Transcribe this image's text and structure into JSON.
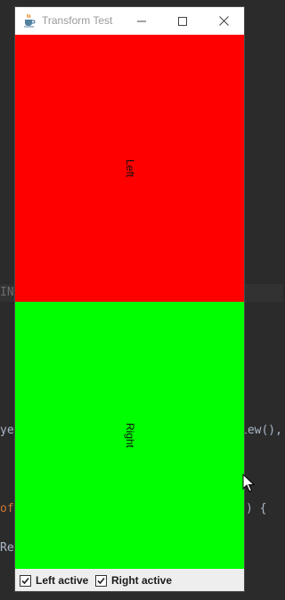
{
  "window": {
    "title": "Transform Test"
  },
  "panels": {
    "left_label": "Left",
    "right_label": "Right",
    "left_color": "#ff0000",
    "right_color": "#00ff00"
  },
  "controls": {
    "left_active_label": "Left active",
    "right_active_label": "Right active",
    "left_active_checked": true,
    "right_active_checked": true
  },
  "background_code": {
    "line_1": "IN",
    "line_2_left": "ye",
    "line_2_right": "iew(),",
    "line_3_left": "of",
    "line_3_right": ") {",
    "line_4": "Rep"
  },
  "icons": {
    "app": "java-cup-icon",
    "minimize": "minimize-icon",
    "maximize": "maximize-icon",
    "close": "close-icon",
    "cursor": "mouse-cursor-icon"
  }
}
